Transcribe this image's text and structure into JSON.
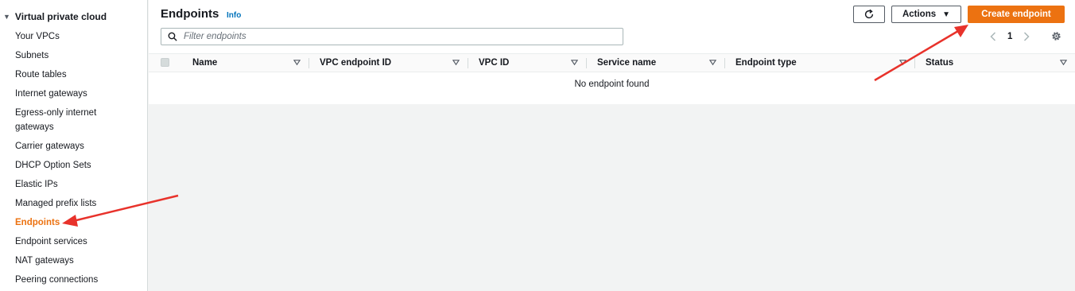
{
  "sidebar": {
    "section_title": "Virtual private cloud",
    "items": [
      {
        "label": "Your VPCs"
      },
      {
        "label": "Subnets"
      },
      {
        "label": "Route tables"
      },
      {
        "label": "Internet gateways"
      },
      {
        "label": "Egress-only internet gateways"
      },
      {
        "label": "Carrier gateways"
      },
      {
        "label": "DHCP Option Sets"
      },
      {
        "label": "Elastic IPs"
      },
      {
        "label": "Managed prefix lists"
      },
      {
        "label": "Endpoints",
        "active": true
      },
      {
        "label": "Endpoint services"
      },
      {
        "label": "NAT gateways"
      },
      {
        "label": "Peering connections"
      }
    ]
  },
  "header": {
    "title": "Endpoints",
    "info_label": "Info",
    "refresh_icon": "refresh-icon",
    "actions_label": "Actions",
    "create_label": "Create endpoint"
  },
  "search": {
    "placeholder": "Filter endpoints",
    "value": ""
  },
  "pagination": {
    "current_page": "1"
  },
  "table": {
    "columns": [
      "Name",
      "VPC endpoint ID",
      "VPC ID",
      "Service name",
      "Endpoint type",
      "Status"
    ],
    "empty_message": "No endpoint found"
  },
  "colors": {
    "accent": "#ec7211",
    "link": "#0073bb",
    "annotation_arrow": "#e8322b"
  }
}
